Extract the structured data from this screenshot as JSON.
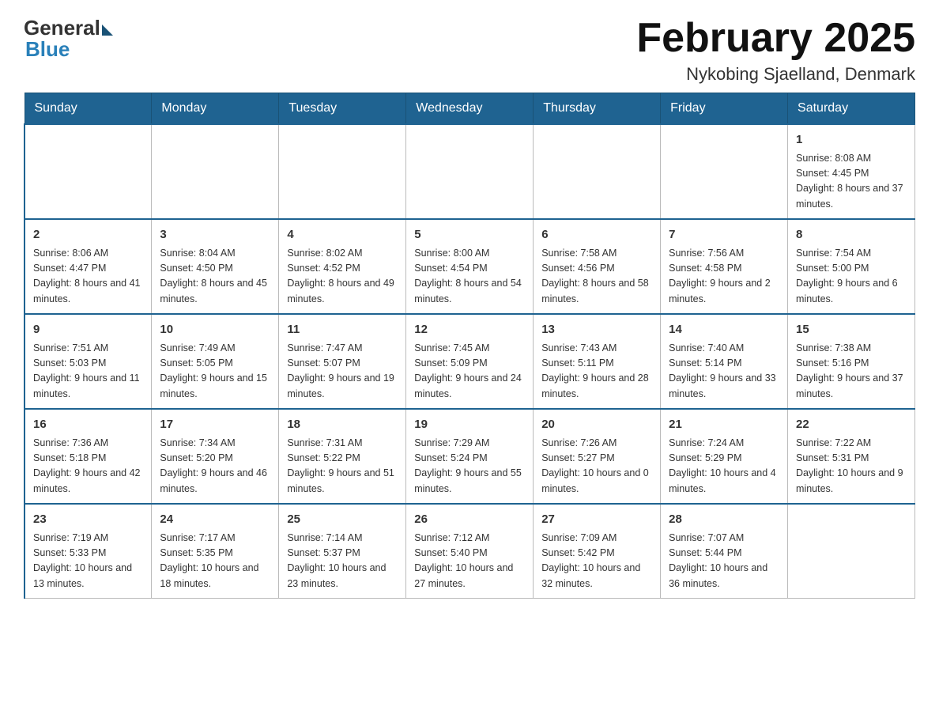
{
  "logo": {
    "text_general": "General",
    "text_blue": "Blue"
  },
  "title": "February 2025",
  "subtitle": "Nykobing Sjaelland, Denmark",
  "weekdays": [
    "Sunday",
    "Monday",
    "Tuesday",
    "Wednesday",
    "Thursday",
    "Friday",
    "Saturday"
  ],
  "weeks": [
    [
      {
        "day": "",
        "info": ""
      },
      {
        "day": "",
        "info": ""
      },
      {
        "day": "",
        "info": ""
      },
      {
        "day": "",
        "info": ""
      },
      {
        "day": "",
        "info": ""
      },
      {
        "day": "",
        "info": ""
      },
      {
        "day": "1",
        "info": "Sunrise: 8:08 AM\nSunset: 4:45 PM\nDaylight: 8 hours and 37 minutes."
      }
    ],
    [
      {
        "day": "2",
        "info": "Sunrise: 8:06 AM\nSunset: 4:47 PM\nDaylight: 8 hours and 41 minutes."
      },
      {
        "day": "3",
        "info": "Sunrise: 8:04 AM\nSunset: 4:50 PM\nDaylight: 8 hours and 45 minutes."
      },
      {
        "day": "4",
        "info": "Sunrise: 8:02 AM\nSunset: 4:52 PM\nDaylight: 8 hours and 49 minutes."
      },
      {
        "day": "5",
        "info": "Sunrise: 8:00 AM\nSunset: 4:54 PM\nDaylight: 8 hours and 54 minutes."
      },
      {
        "day": "6",
        "info": "Sunrise: 7:58 AM\nSunset: 4:56 PM\nDaylight: 8 hours and 58 minutes."
      },
      {
        "day": "7",
        "info": "Sunrise: 7:56 AM\nSunset: 4:58 PM\nDaylight: 9 hours and 2 minutes."
      },
      {
        "day": "8",
        "info": "Sunrise: 7:54 AM\nSunset: 5:00 PM\nDaylight: 9 hours and 6 minutes."
      }
    ],
    [
      {
        "day": "9",
        "info": "Sunrise: 7:51 AM\nSunset: 5:03 PM\nDaylight: 9 hours and 11 minutes."
      },
      {
        "day": "10",
        "info": "Sunrise: 7:49 AM\nSunset: 5:05 PM\nDaylight: 9 hours and 15 minutes."
      },
      {
        "day": "11",
        "info": "Sunrise: 7:47 AM\nSunset: 5:07 PM\nDaylight: 9 hours and 19 minutes."
      },
      {
        "day": "12",
        "info": "Sunrise: 7:45 AM\nSunset: 5:09 PM\nDaylight: 9 hours and 24 minutes."
      },
      {
        "day": "13",
        "info": "Sunrise: 7:43 AM\nSunset: 5:11 PM\nDaylight: 9 hours and 28 minutes."
      },
      {
        "day": "14",
        "info": "Sunrise: 7:40 AM\nSunset: 5:14 PM\nDaylight: 9 hours and 33 minutes."
      },
      {
        "day": "15",
        "info": "Sunrise: 7:38 AM\nSunset: 5:16 PM\nDaylight: 9 hours and 37 minutes."
      }
    ],
    [
      {
        "day": "16",
        "info": "Sunrise: 7:36 AM\nSunset: 5:18 PM\nDaylight: 9 hours and 42 minutes."
      },
      {
        "day": "17",
        "info": "Sunrise: 7:34 AM\nSunset: 5:20 PM\nDaylight: 9 hours and 46 minutes."
      },
      {
        "day": "18",
        "info": "Sunrise: 7:31 AM\nSunset: 5:22 PM\nDaylight: 9 hours and 51 minutes."
      },
      {
        "day": "19",
        "info": "Sunrise: 7:29 AM\nSunset: 5:24 PM\nDaylight: 9 hours and 55 minutes."
      },
      {
        "day": "20",
        "info": "Sunrise: 7:26 AM\nSunset: 5:27 PM\nDaylight: 10 hours and 0 minutes."
      },
      {
        "day": "21",
        "info": "Sunrise: 7:24 AM\nSunset: 5:29 PM\nDaylight: 10 hours and 4 minutes."
      },
      {
        "day": "22",
        "info": "Sunrise: 7:22 AM\nSunset: 5:31 PM\nDaylight: 10 hours and 9 minutes."
      }
    ],
    [
      {
        "day": "23",
        "info": "Sunrise: 7:19 AM\nSunset: 5:33 PM\nDaylight: 10 hours and 13 minutes."
      },
      {
        "day": "24",
        "info": "Sunrise: 7:17 AM\nSunset: 5:35 PM\nDaylight: 10 hours and 18 minutes."
      },
      {
        "day": "25",
        "info": "Sunrise: 7:14 AM\nSunset: 5:37 PM\nDaylight: 10 hours and 23 minutes."
      },
      {
        "day": "26",
        "info": "Sunrise: 7:12 AM\nSunset: 5:40 PM\nDaylight: 10 hours and 27 minutes."
      },
      {
        "day": "27",
        "info": "Sunrise: 7:09 AM\nSunset: 5:42 PM\nDaylight: 10 hours and 32 minutes."
      },
      {
        "day": "28",
        "info": "Sunrise: 7:07 AM\nSunset: 5:44 PM\nDaylight: 10 hours and 36 minutes."
      },
      {
        "day": "",
        "info": ""
      }
    ]
  ]
}
